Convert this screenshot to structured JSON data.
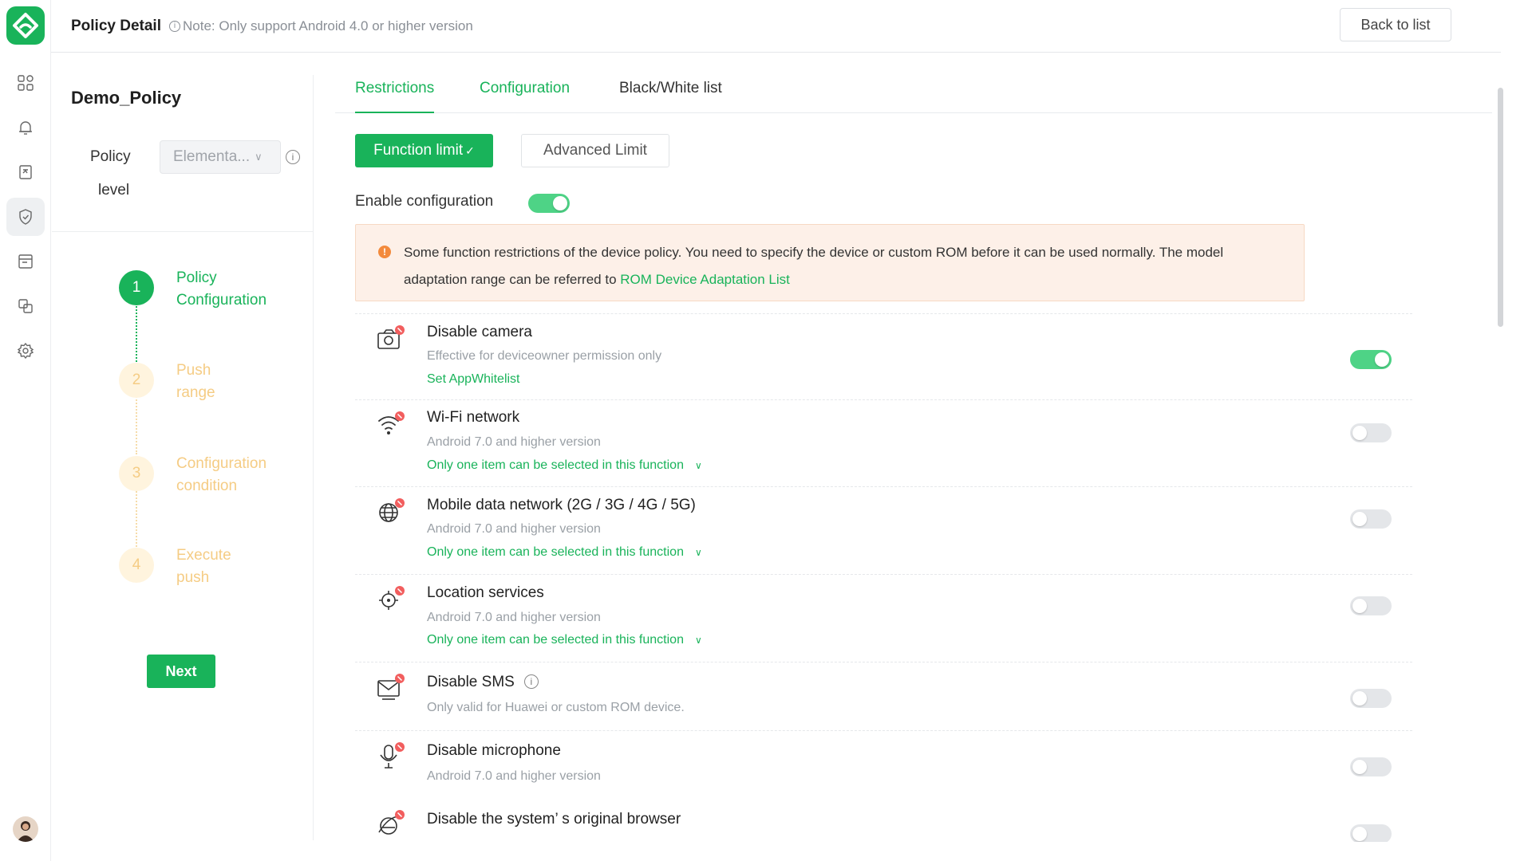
{
  "header": {
    "title": "Policy Detail",
    "note": "Note: Only support Android 4.0 or higher version",
    "back_label": "Back to list"
  },
  "rail": {
    "items": [
      "dashboard-icon",
      "bell-icon",
      "report-icon",
      "shield-icon",
      "store-icon",
      "copy-icon",
      "gear-icon"
    ],
    "active": "shield-icon"
  },
  "policy": {
    "name": "Demo_Policy",
    "level_label_1": "Policy",
    "level_label_2": "level",
    "level_value": "Elementa..."
  },
  "steps": [
    {
      "num": "1",
      "line1": "Policy",
      "line2": "Configuration",
      "state": "done"
    },
    {
      "num": "2",
      "line1": "Push",
      "line2": "range",
      "state": "todo"
    },
    {
      "num": "3",
      "line1": "Configuration",
      "line2": "condition",
      "state": "todo"
    },
    {
      "num": "4",
      "line1": "Execute",
      "line2": "push",
      "state": "todo"
    }
  ],
  "next_label": "Next",
  "tabs": [
    "Restrictions",
    "Configuration",
    "Black/White list"
  ],
  "segments": {
    "function_limit": "Function limit",
    "advanced_limit": "Advanced Limit"
  },
  "enable": {
    "label": "Enable configuration",
    "on": true
  },
  "alert": {
    "text": "Some function restrictions of the device policy. You need to specify the device or custom ROM before it can be used normally. The model adaptation range can be referred to",
    "link": "ROM Device Adaptation List"
  },
  "items": [
    {
      "title": "Disable camera",
      "sub": "Effective for deviceowner permission only",
      "link": "Set AppWhitelist",
      "on": true,
      "icon": "camera-icon"
    },
    {
      "title": "Wi-Fi network",
      "sub": "Android 7.0 and higher version",
      "link": "Only one item can be selected in this function",
      "on": false,
      "icon": "wifi-icon"
    },
    {
      "title": "Mobile data network (2G / 3G / 4G / 5G)",
      "sub": "Android 7.0 and higher version",
      "link": "Only one item can be selected in this function",
      "on": false,
      "icon": "globe-icon"
    },
    {
      "title": "Location services",
      "sub": "Android 7.0 and higher version",
      "link": "Only one item can be selected in this function",
      "on": false,
      "icon": "location-icon"
    },
    {
      "title": "Disable SMS",
      "sub": "Only valid for Huawei or custom ROM device.",
      "on": false,
      "icon": "sms-icon"
    },
    {
      "title": "Disable microphone",
      "sub": "Android 7.0 and higher version",
      "on": false,
      "icon": "microphone-icon"
    },
    {
      "title": "Disable the system’ s original browser",
      "on": false,
      "icon": "browser-icon"
    }
  ],
  "colors": {
    "brand": "#19b35a",
    "pending": "#f5cc84",
    "switch_on": "#4ed386",
    "alert_bg": "#fdf0e8"
  }
}
